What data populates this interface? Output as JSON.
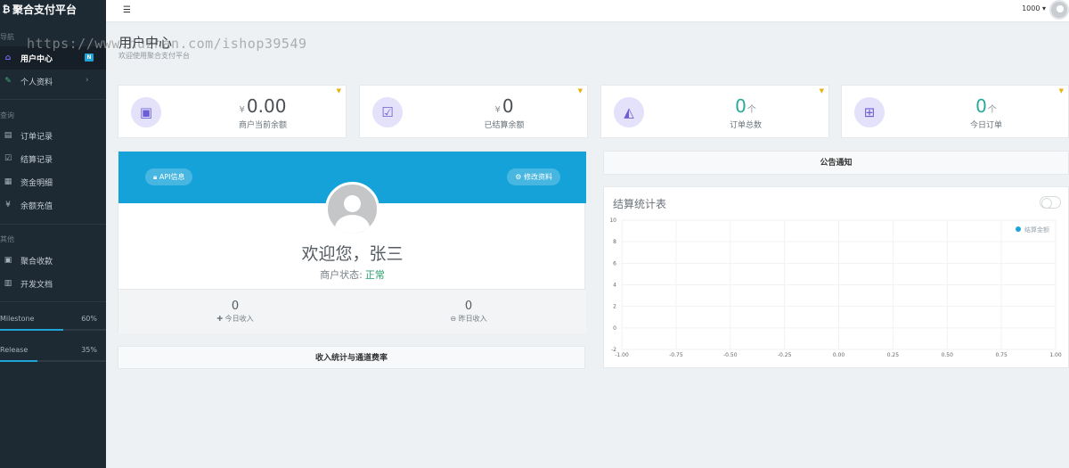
{
  "sidebar": {
    "brand": "聚合支付平台",
    "sections": {
      "nav": "导航",
      "query": "查询",
      "other": "其他"
    },
    "items": [
      {
        "label": "用户中心",
        "icon": "home-icon",
        "glyph": "⌂",
        "badge": "N",
        "active": true
      },
      {
        "label": "个人资料",
        "icon": "leaf-icon",
        "glyph": "✎",
        "chevron": "›"
      },
      {
        "label": "订单记录",
        "icon": "list-icon",
        "glyph": "▤"
      },
      {
        "label": "结算记录",
        "icon": "check-square-icon",
        "glyph": "☑"
      },
      {
        "label": "资金明细",
        "icon": "calendar-icon",
        "glyph": "▦"
      },
      {
        "label": "余额充值",
        "icon": "yen-icon",
        "glyph": "¥"
      },
      {
        "label": "聚合收款",
        "icon": "qrcode-icon",
        "glyph": "▣"
      },
      {
        "label": "开发文档",
        "icon": "book-icon",
        "glyph": "▥"
      }
    ],
    "progress": [
      {
        "label": "Milestone",
        "percent_text": "60%",
        "value": 0.6
      },
      {
        "label": "Release",
        "percent_text": "35%",
        "value": 0.35
      }
    ]
  },
  "topbar": {
    "user_label": "1000 ▾",
    "menu_icon": "menu-icon"
  },
  "watermark": "https://www.huzhan.com/ishop39549",
  "header": {
    "title": "用户中心",
    "subtitle": "欢迎使用聚合支付平台"
  },
  "stats": [
    {
      "prefix": "¥",
      "value": "0.00",
      "suffix": "",
      "label": "商户当前余额",
      "icon": "money-icon",
      "glyph": "▣",
      "color": "gray"
    },
    {
      "prefix": "¥",
      "value": "0",
      "suffix": "",
      "label": "已结算余额",
      "icon": "check-square-icon",
      "glyph": "☑",
      "color": "gray"
    },
    {
      "prefix": "",
      "value": "0",
      "suffix": "个",
      "label": "订单总数",
      "icon": "area-chart-icon",
      "glyph": "◭",
      "color": "teal"
    },
    {
      "prefix": "",
      "value": "0",
      "suffix": "个",
      "label": "今日订单",
      "icon": "cart-icon",
      "glyph": "⊞",
      "color": "teal"
    }
  ],
  "profile": {
    "api_button": "API信息",
    "edit_button": "修改资料",
    "welcome": "欢迎您，张三",
    "status_label": "商户状态:",
    "status_value": "正常",
    "today_income_value": "0",
    "today_income_label": "今日收入",
    "yesterday_income_value": "0",
    "yesterday_income_label": "昨日收入"
  },
  "income_panel_title": "收入统计与通道费率",
  "notice_title": "公告通知",
  "chart_data": {
    "type": "line",
    "title": "结算统计表",
    "series": [
      {
        "name": "结算金额",
        "values": [],
        "color": "#1fa4d8"
      }
    ],
    "x_ticks": [
      "-1.00",
      "-0.75",
      "-0.50",
      "-0.25",
      "0.00",
      "0.25",
      "0.50",
      "0.75",
      "1.00"
    ],
    "y_ticks": [
      "10",
      "8",
      "6",
      "4",
      "2",
      "0",
      "-2"
    ],
    "xlim": [
      -1,
      1
    ],
    "ylim": [
      -2,
      10
    ],
    "grid": true,
    "legend": "top-right"
  }
}
